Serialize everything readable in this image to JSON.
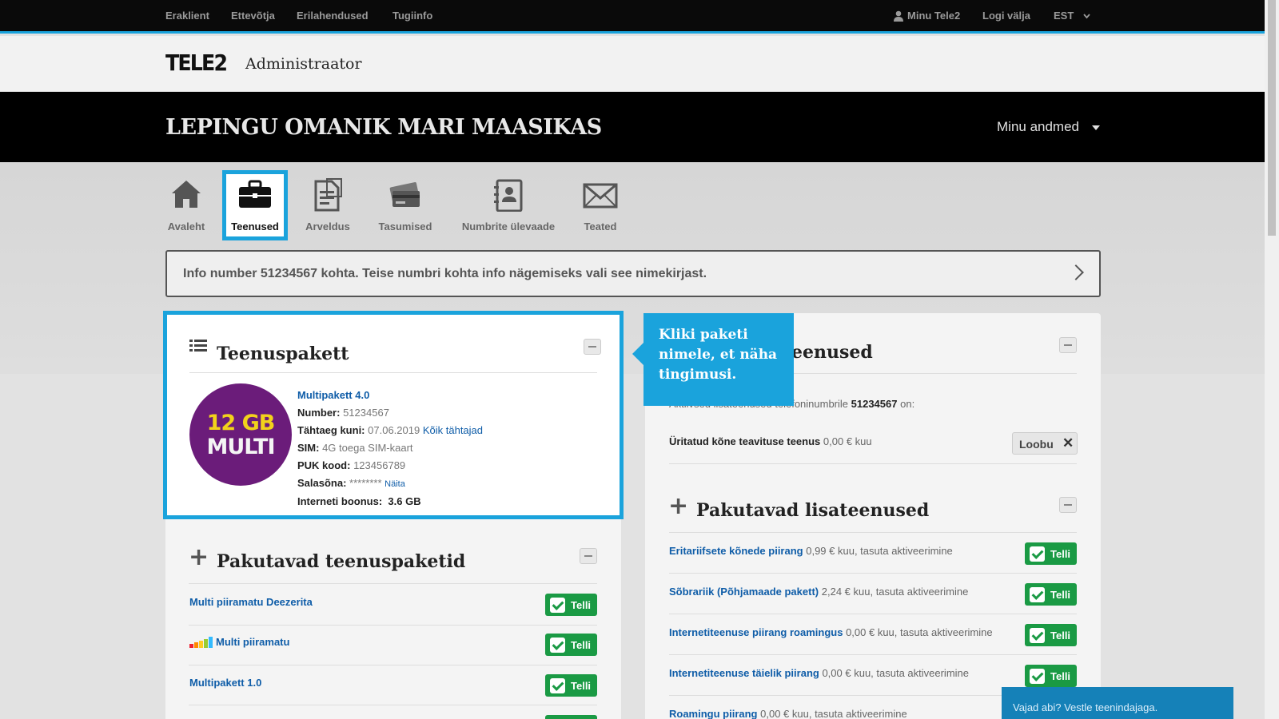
{
  "topbar": {
    "links": [
      "Eraklient",
      "Ettevõtja",
      "Erilahendused",
      "Tugiinfo"
    ],
    "my_tele2": "Minu Tele2",
    "logout": "Logi välja",
    "language": "EST"
  },
  "header": {
    "logo": "TELE2",
    "title": "Administraator"
  },
  "band": {
    "owner": "LEPINGU OMANIK MARI MAASIKAS",
    "my_data": "Minu andmed"
  },
  "nav": [
    {
      "label": "Avaleht",
      "icon": "home-icon"
    },
    {
      "label": "Teenused",
      "icon": "briefcase-icon",
      "active": true
    },
    {
      "label": "Arveldus",
      "icon": "invoice-icon"
    },
    {
      "label": "Tasumised",
      "icon": "cards-icon"
    },
    {
      "label": "Numbrite ülevaade",
      "icon": "contacts-icon"
    },
    {
      "label": "Teated",
      "icon": "envelope-icon"
    }
  ],
  "infobar": {
    "text": "Info number 51234567 kohta. Teise numbri kohta info nägemiseks vali see nimekirjast."
  },
  "package_card": {
    "title": "Teenuspakett",
    "badge_line1": "12 GB",
    "badge_line2": "MULTI",
    "package_name": "Multipakett 4.0",
    "number_label": "Number:",
    "number_value": "51234567",
    "deadline_label": "Tähtaeg kuni:",
    "deadline_value": "07.06.2019",
    "all_deadlines_link": "Kõik tähtajad",
    "sim_label": "SIM:",
    "sim_value": "4G toega SIM-kaart",
    "puk_label": "PUK kood:",
    "puk_value": "123456789",
    "password_label": "Salasõna:",
    "password_value": "********",
    "show_link": "Näita",
    "bonus_label": "Interneti boonus:",
    "bonus_value": "3.6 GB"
  },
  "tooltip": {
    "text": "Kliki paketi nimele, et näha tingimusi."
  },
  "offered_packages": {
    "title": "Pakutavad teenuspaketid",
    "order_label": "Telli",
    "items": [
      {
        "name": "Multi piiramatu Deezerita"
      },
      {
        "name": "Multi piiramatu"
      },
      {
        "name": "Multipakett 1.0"
      }
    ]
  },
  "active_services": {
    "title_visible": "eenused",
    "intro_start": "Aktiivsed lisateenused telefoninumbrile",
    "intro_number": "51234567",
    "intro_end": "on:",
    "items": [
      {
        "name": "Üritatud kõne teavituse teenus",
        "price": "0,00 € kuu",
        "action": "Loobu"
      }
    ]
  },
  "offered_addons": {
    "title": "Pakutavad lisateenused",
    "order_label": "Telli",
    "items": [
      {
        "name": "Eritariifsete kõnede piirang",
        "desc": "0,99 € kuu, tasuta aktiveerimine"
      },
      {
        "name": "Sõbrariik (Põhjamaade pakett)",
        "desc": "2,24 € kuu, tasuta aktiveerimine"
      },
      {
        "name": "Internetiteenuse piirang roamingus",
        "desc": "0,00 € kuu, tasuta aktiveerimine"
      },
      {
        "name": "Internetiteenuse täielik piirang",
        "desc": "0,00 € kuu, tasuta aktiveerimine"
      },
      {
        "name": "Roamingu piirang",
        "desc": "0,00 € kuu, tasuta aktiveerimine"
      }
    ]
  },
  "chat": {
    "text": "Vajad abi? Vestle teenindajaga."
  },
  "colors": {
    "accent": "#1aa3dc",
    "order_green": "#1a9a44",
    "link_blue": "#0f5da8",
    "badge_purple": "#6b1c7a"
  }
}
